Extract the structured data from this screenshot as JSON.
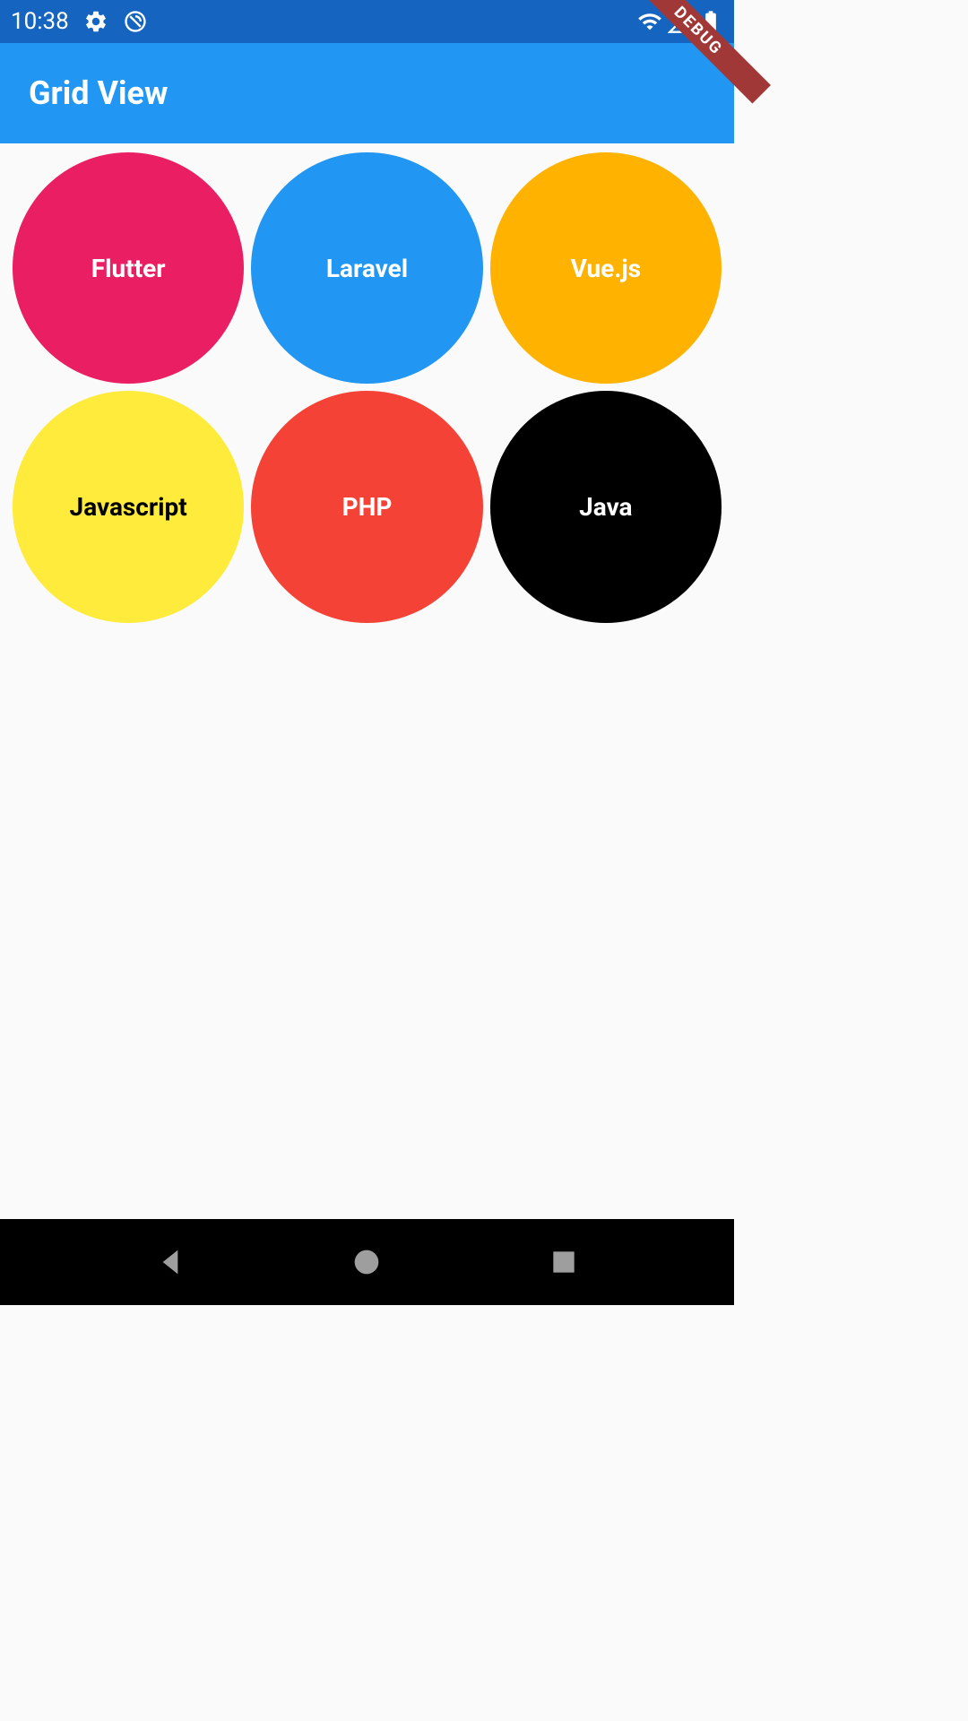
{
  "status": {
    "time": "10:38"
  },
  "appbar": {
    "title": "Grid View"
  },
  "debug": {
    "label": "DEBUG"
  },
  "grid": {
    "items": [
      {
        "label": "Flutter",
        "bg": "#e91e63",
        "fg": "#ffffff"
      },
      {
        "label": "Laravel",
        "bg": "#2196f3",
        "fg": "#ffffff"
      },
      {
        "label": "Vue.js",
        "bg": "#ffb300",
        "fg": "#ffffff"
      },
      {
        "label": "Javascript",
        "bg": "#ffeb3b",
        "fg": "#000000"
      },
      {
        "label": "PHP",
        "bg": "#f44336",
        "fg": "#ffffff"
      },
      {
        "label": "Java",
        "bg": "#000000",
        "fg": "#ffffff"
      }
    ]
  }
}
